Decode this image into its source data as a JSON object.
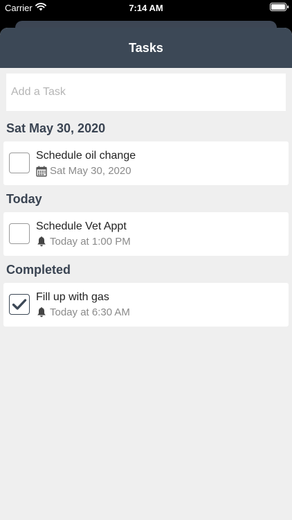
{
  "status_bar": {
    "carrier": "Carrier",
    "time": "7:14 AM"
  },
  "header": {
    "title": "Tasks"
  },
  "add_task": {
    "placeholder": "Add a Task",
    "value": ""
  },
  "sections": [
    {
      "title": "Sat May 30, 2020",
      "tasks": [
        {
          "title": "Schedule oil change",
          "meta": "Sat May 30, 2020",
          "icon": "calendar-icon",
          "completed": false
        }
      ]
    },
    {
      "title": "Today",
      "tasks": [
        {
          "title": "Schedule Vet Appt",
          "meta": "Today at 1:00 PM",
          "icon": "bell-icon",
          "completed": false
        }
      ]
    },
    {
      "title": "Completed",
      "tasks": [
        {
          "title": "Fill up with gas",
          "meta": "Today at 6:30 AM",
          "icon": "bell-icon",
          "completed": true
        }
      ]
    }
  ],
  "colors": {
    "header_bg": "#3c4856",
    "background": "#efefef",
    "section_text": "#3a4452",
    "meta_text": "#8a8a8a"
  }
}
